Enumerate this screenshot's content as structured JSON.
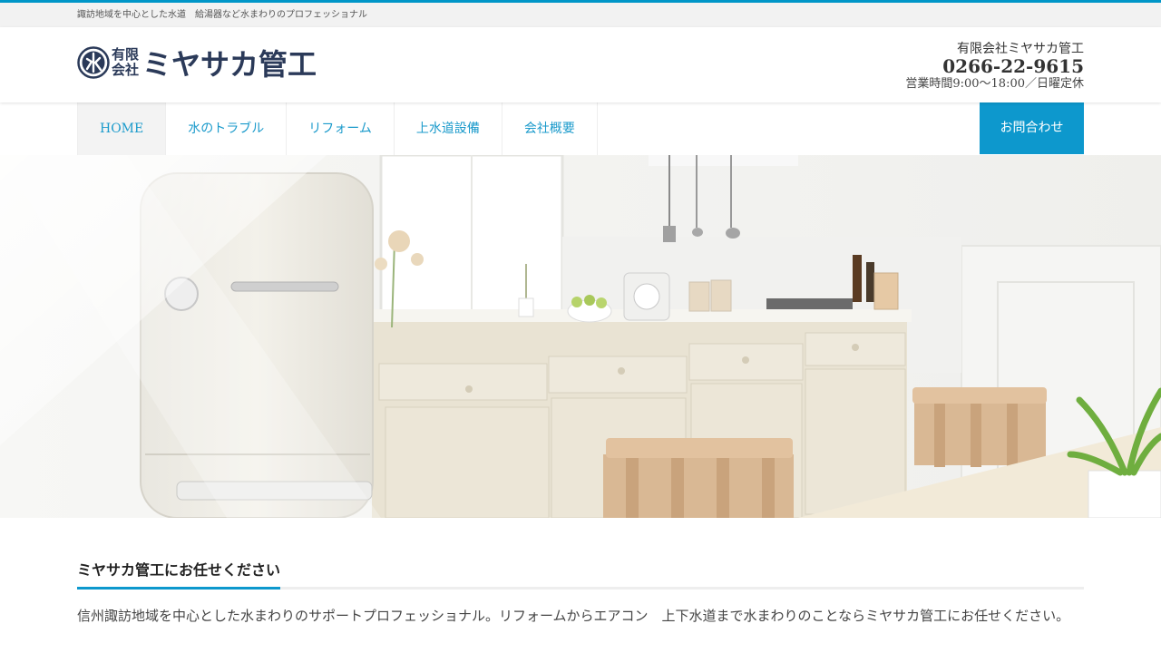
{
  "top_bar": {
    "tagline": "諏訪地域を中心とした水道　給湯器など水まわりのプロフェッショナル"
  },
  "header": {
    "logo": {
      "mark_letter": "水",
      "small_line1": "有限",
      "small_line2": "会社",
      "name": "ミヤサカ管工"
    },
    "contact": {
      "company": "有限会社ミヤサカ管工",
      "phone": "0266-22-9615",
      "hours": "営業時間9:00〜18:00／日曜定休"
    }
  },
  "nav": {
    "items": [
      {
        "label": "HOME",
        "active": true
      },
      {
        "label": "水のトラブル",
        "active": false
      },
      {
        "label": "リフォーム",
        "active": false
      },
      {
        "label": "上水道設備",
        "active": false
      },
      {
        "label": "会社概要",
        "active": false
      }
    ],
    "cta_label": "お問合わせ"
  },
  "hero": {
    "description_icon": "kitchen-photo"
  },
  "intro": {
    "heading": "ミヤサカ管工にお任せください",
    "text": "信州諏訪地域を中心とした水まわりのサポートプロフェッショナル。リフォームからエアコン　上下水道まで水まわりのことならミヤサカ管工にお任せください。"
  },
  "colors": {
    "accent": "#0d98cd",
    "nav_text": "#1a9acb",
    "logo": "#2b3a59",
    "tagline_bg": "#f2f2f2"
  }
}
